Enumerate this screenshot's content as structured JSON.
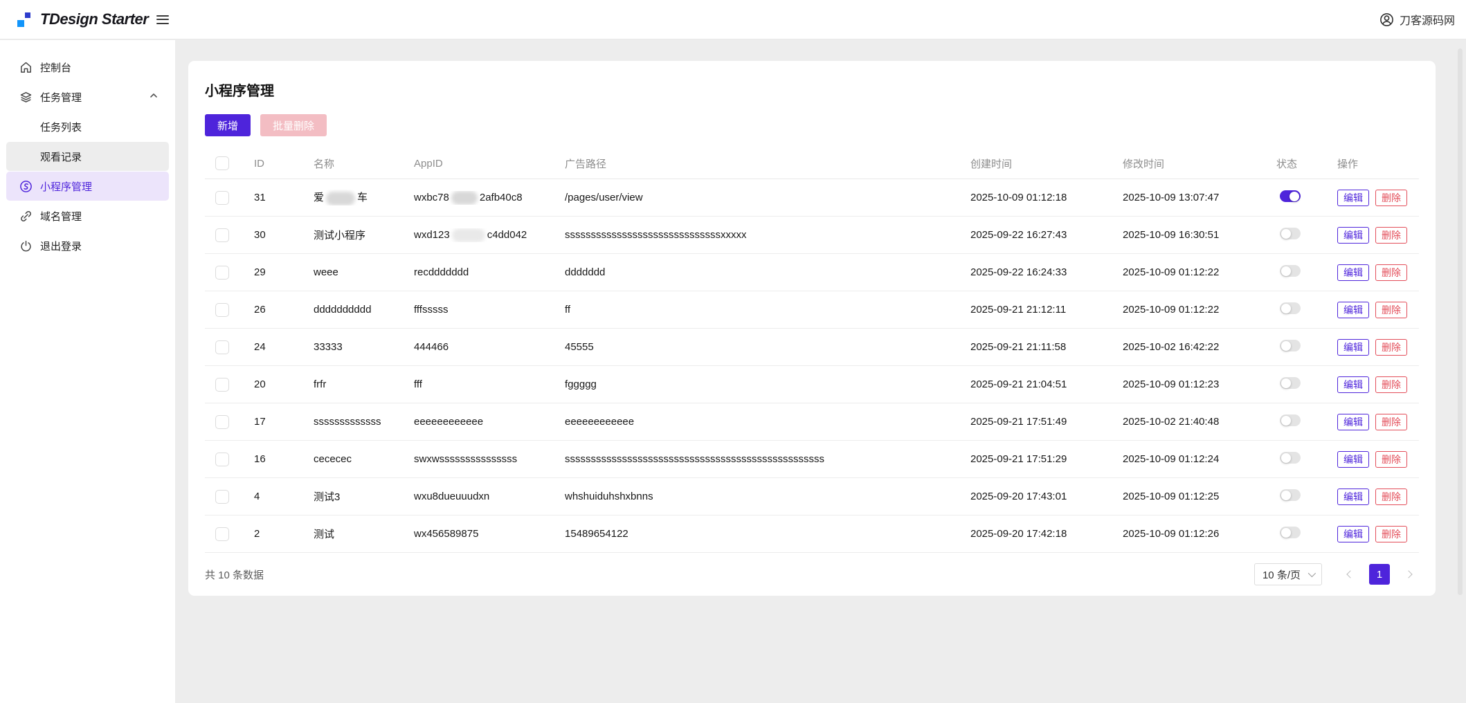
{
  "header": {
    "logo_text": "TDesign Starter",
    "user_name": "刀客源码网"
  },
  "sidebar": {
    "items": [
      {
        "key": "console",
        "label": "控制台",
        "icon": "home-icon"
      },
      {
        "key": "task-management",
        "label": "任务管理",
        "icon": "layers-icon",
        "chevron": true
      },
      {
        "key": "task-list",
        "label": "任务列表",
        "sub": true
      },
      {
        "key": "watch-records",
        "label": "观看记录",
        "sub": true,
        "hover": true
      },
      {
        "key": "miniprogram-management",
        "label": "小程序管理",
        "icon": "miniprogram-icon",
        "active": true
      },
      {
        "key": "domain-management",
        "label": "域名管理",
        "icon": "link-icon"
      },
      {
        "key": "logout",
        "label": "退出登录",
        "icon": "power-icon"
      }
    ]
  },
  "main": {
    "title": "小程序管理",
    "buttons": {
      "add_label": "新增",
      "batch_delete_label": "批量删除"
    },
    "table": {
      "columns": [
        "ID",
        "名称",
        "AppID",
        "广告路径",
        "创建时间",
        "修改时间",
        "状态",
        "操作"
      ],
      "edit_label": "编辑",
      "delete_label": "删除",
      "rows": [
        {
          "id": "31",
          "name_parts": [
            [
              "text",
              "爱"
            ],
            [
              "blur",
              42
            ],
            [
              "text",
              "车"
            ]
          ],
          "appid_parts": [
            [
              "text",
              "wxbc78"
            ],
            [
              "blur",
              38
            ],
            [
              "text",
              "2afb40c8"
            ]
          ],
          "ad_path": "/pages/user/view",
          "created": "2025-10-09 01:12:18",
          "modified": "2025-10-09 13:07:47",
          "status": true
        },
        {
          "id": "30",
          "name_parts": [
            [
              "text",
              "测试小程序"
            ]
          ],
          "appid_parts": [
            [
              "text",
              "wxd123"
            ],
            [
              "blur-light",
              48
            ],
            [
              "text",
              "c4dd042"
            ]
          ],
          "ad_path": "ssssssssssssssssssssssssssssssxxxxx",
          "created": "2025-09-22 16:27:43",
          "modified": "2025-10-09 16:30:51",
          "status": false
        },
        {
          "id": "29",
          "name_parts": [
            [
              "text",
              "weee"
            ]
          ],
          "appid_parts": [
            [
              "text",
              "recddddddd"
            ]
          ],
          "ad_path": "ddddddd",
          "created": "2025-09-22 16:24:33",
          "modified": "2025-10-09 01:12:22",
          "status": false
        },
        {
          "id": "26",
          "name_parts": [
            [
              "text",
              "dddddddddd"
            ]
          ],
          "appid_parts": [
            [
              "text",
              "fffsssss"
            ]
          ],
          "ad_path": "ff",
          "created": "2025-09-21 21:12:11",
          "modified": "2025-10-09 01:12:22",
          "status": false
        },
        {
          "id": "24",
          "name_parts": [
            [
              "text",
              "33333"
            ]
          ],
          "appid_parts": [
            [
              "text",
              "444466"
            ]
          ],
          "ad_path": "45555",
          "created": "2025-09-21 21:11:58",
          "modified": "2025-10-02 16:42:22",
          "status": false
        },
        {
          "id": "20",
          "name_parts": [
            [
              "text",
              "frfr"
            ]
          ],
          "appid_parts": [
            [
              "text",
              "fff"
            ]
          ],
          "ad_path": "fggggg",
          "created": "2025-09-21 21:04:51",
          "modified": "2025-10-09 01:12:23",
          "status": false
        },
        {
          "id": "17",
          "name_parts": [
            [
              "text",
              "sssssssssssss"
            ]
          ],
          "appid_parts": [
            [
              "text",
              "eeeeeeeeeeee"
            ]
          ],
          "ad_path": "eeeeeeeeeeee",
          "created": "2025-09-21 17:51:49",
          "modified": "2025-10-02 21:40:48",
          "status": false
        },
        {
          "id": "16",
          "name_parts": [
            [
              "text",
              "cececec"
            ]
          ],
          "appid_parts": [
            [
              "text",
              "swxwsssssssssssssss"
            ]
          ],
          "ad_path": "ssssssssssssssssssssssssssssssssssssssssssssssssss",
          "created": "2025-09-21 17:51:29",
          "modified": "2025-10-09 01:12:24",
          "status": false
        },
        {
          "id": "4",
          "name_parts": [
            [
              "text",
              "测试3"
            ]
          ],
          "appid_parts": [
            [
              "text",
              "wxu8dueuuudxn"
            ]
          ],
          "ad_path": "whshuiduhshxbnns",
          "created": "2025-09-20 17:43:01",
          "modified": "2025-10-09 01:12:25",
          "status": false
        },
        {
          "id": "2",
          "name_parts": [
            [
              "text",
              "测试"
            ]
          ],
          "appid_parts": [
            [
              "text",
              "wx456589875"
            ]
          ],
          "ad_path": "15489654122",
          "created": "2025-09-20 17:42:18",
          "modified": "2025-10-09 01:12:26",
          "status": false
        }
      ]
    },
    "footer": {
      "total_text": "共 10 条数据",
      "page_size_label": "10 条/页",
      "current_page": "1"
    }
  },
  "colors": {
    "primary": "#4e24db",
    "primary_light_bg": "#ece4fb",
    "danger": "#e34d59",
    "danger_disabled_bg": "#f3bdc3",
    "toggle_off": "#e4e4e4",
    "page_bg": "#ededed",
    "header_text": "#8c8c8c"
  }
}
